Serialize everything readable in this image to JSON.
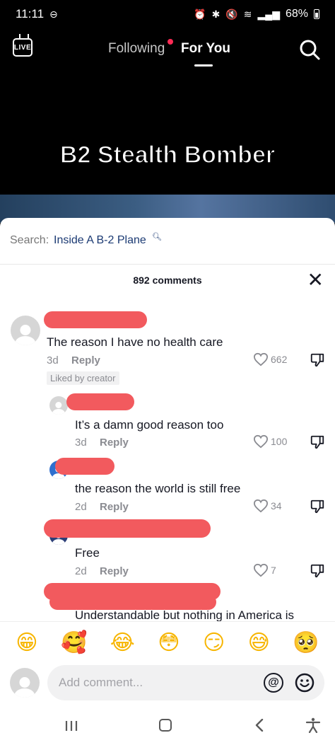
{
  "status_bar": {
    "time": "11:11",
    "battery": "68%"
  },
  "top_nav": {
    "live_label": "LIVE",
    "tab_following": "Following",
    "tab_for_you": "For You"
  },
  "video": {
    "title_overlay": "B2 Stealth Bomber"
  },
  "search_suggestion": {
    "prefix": "Search:",
    "term": "Inside A B-2 Plane"
  },
  "comments": {
    "count_label": "892 comments",
    "items": [
      {
        "text": "The reason I have no health care",
        "age": "3d",
        "reply_label": "Reply",
        "likes": "662",
        "badge": "Liked by creator"
      },
      {
        "text": "It’s a damn good reason too",
        "age": "3d",
        "reply_label": "Reply",
        "likes": "100"
      },
      {
        "text": "the reason the world is still free",
        "age": "2d",
        "reply_label": "Reply",
        "likes": "34"
      },
      {
        "text": "Free",
        "age": "2d",
        "reply_label": "Reply",
        "likes": "7"
      },
      {
        "text": "Understandable but nothing in America is"
      }
    ]
  },
  "emoji_bar": [
    "😁",
    "🥰",
    "😂",
    "😳",
    "😏",
    "😅",
    "🥺"
  ],
  "add_comment": {
    "placeholder": "Add comment..."
  },
  "colors": {
    "redaction": "#f25a5e",
    "accent_dot": "#ff2b55",
    "search_term": "#1b3a73"
  }
}
